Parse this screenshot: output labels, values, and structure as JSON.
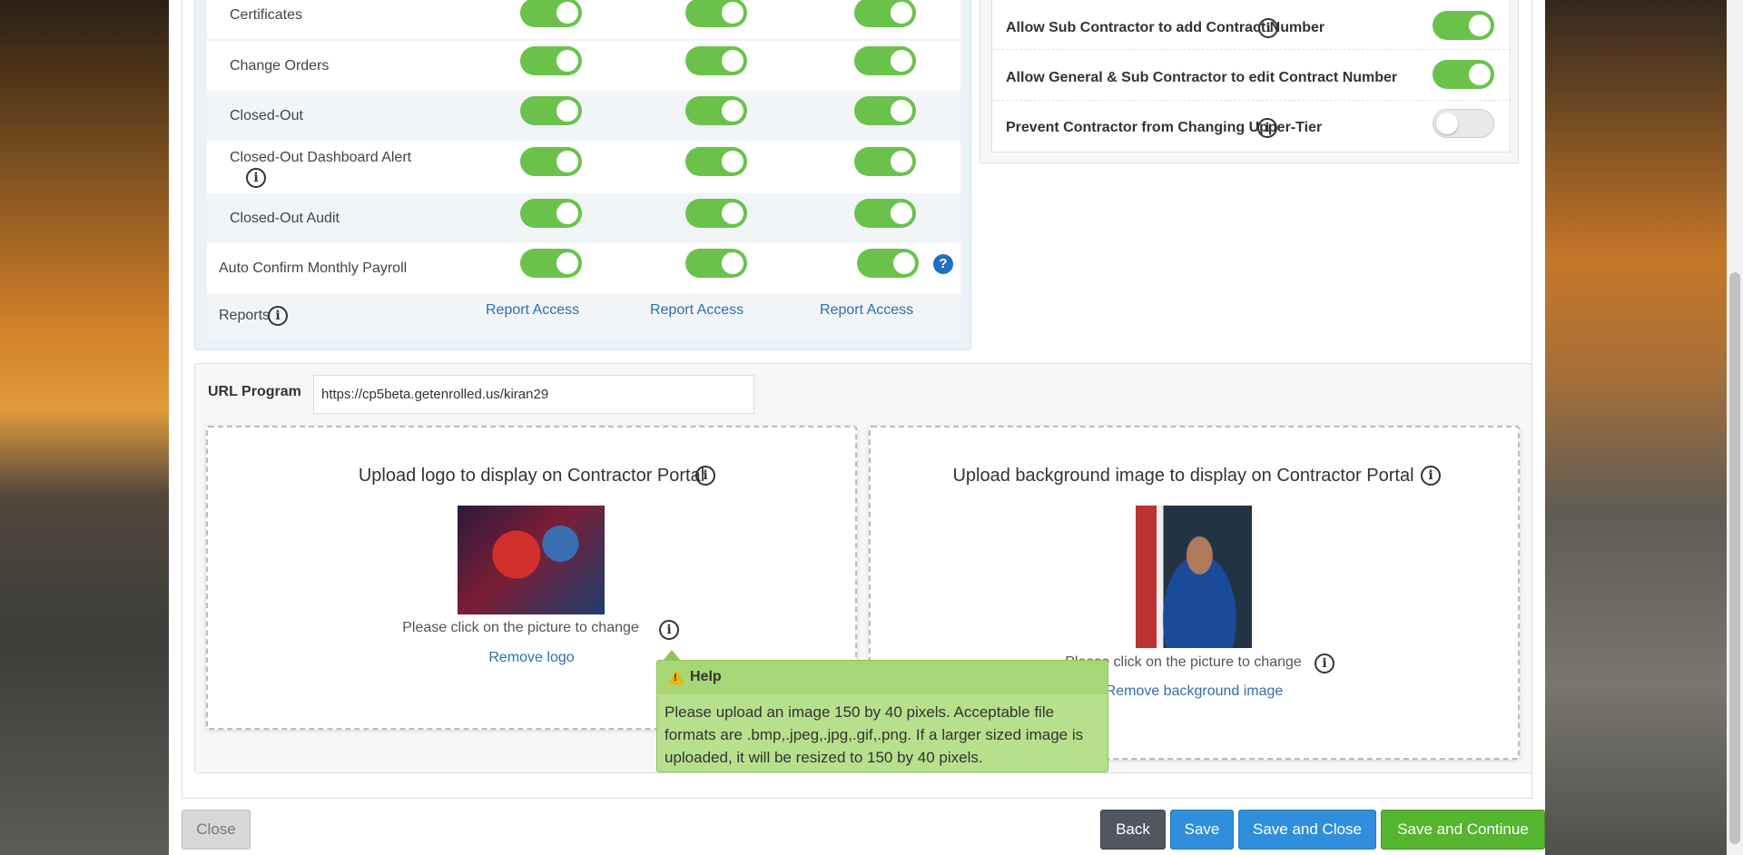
{
  "permissions": {
    "rows": [
      {
        "label": "Certificates"
      },
      {
        "label": "Change Orders"
      },
      {
        "label": "Closed-Out"
      },
      {
        "label": "Closed-Out Dashboard Alert"
      },
      {
        "label": "Closed-Out Audit"
      },
      {
        "label": "Auto Confirm Monthly Payroll"
      },
      {
        "label": "Reports"
      }
    ],
    "report_links": [
      "Report Access",
      "Report Access",
      "Report Access"
    ]
  },
  "settings": {
    "rows": [
      {
        "label": "Allow Sub Contractor to add Contract Number",
        "enabled": true
      },
      {
        "label": "Allow General & Sub Contractor to edit Contract Number",
        "enabled": true
      },
      {
        "label": "Prevent Contractor from Changing Upper-Tier",
        "enabled": false
      }
    ]
  },
  "url_program": {
    "label": "URL Program",
    "value": "https://cp5beta.getenrolled.us/kiran29"
  },
  "upload_logo": {
    "title": "Upload logo to display on Contractor Portal",
    "note": "Please click on the picture to change",
    "remove": "Remove logo"
  },
  "upload_background": {
    "title": "Upload background image to display on Contractor Portal",
    "note": "Please click on the picture to change",
    "remove": "Remove background image"
  },
  "tooltip": {
    "title": "Help",
    "body": "Please upload an image 150 by 40 pixels. Acceptable file formats are .bmp,.jpeg,.jpg,.gif,.png. If a larger sized image is uploaded, it will be resized to 150 by 40 pixels."
  },
  "buttons": {
    "close": "Close",
    "back": "Back",
    "save": "Save",
    "save_close": "Save and Close",
    "save_continue": "Save and Continue"
  },
  "colors": {
    "toggle_on": "#6ac24b",
    "link": "#2f6eaf",
    "save_blue": "#2f8fdc",
    "continue_green": "#55b52e",
    "tooltip_green": "#b7e08c"
  }
}
